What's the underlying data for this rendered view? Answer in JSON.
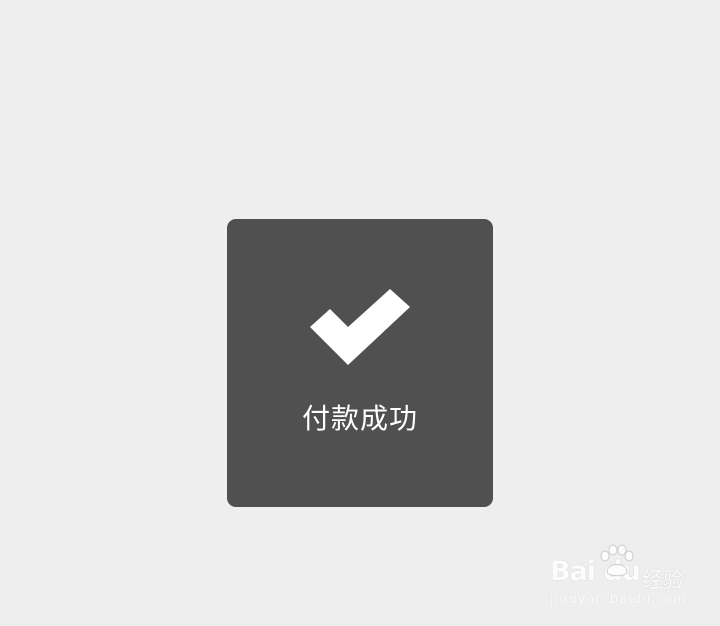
{
  "toast": {
    "icon": "checkmark-icon",
    "message": "付款成功",
    "background_color": "#505050",
    "text_color": "#ffffff"
  },
  "page": {
    "background_color": "#eeeeee"
  },
  "watermark": {
    "brand": "Bai du",
    "suffix": "经验",
    "url": "jingyan.baidu.com",
    "icon": "paw-icon"
  }
}
